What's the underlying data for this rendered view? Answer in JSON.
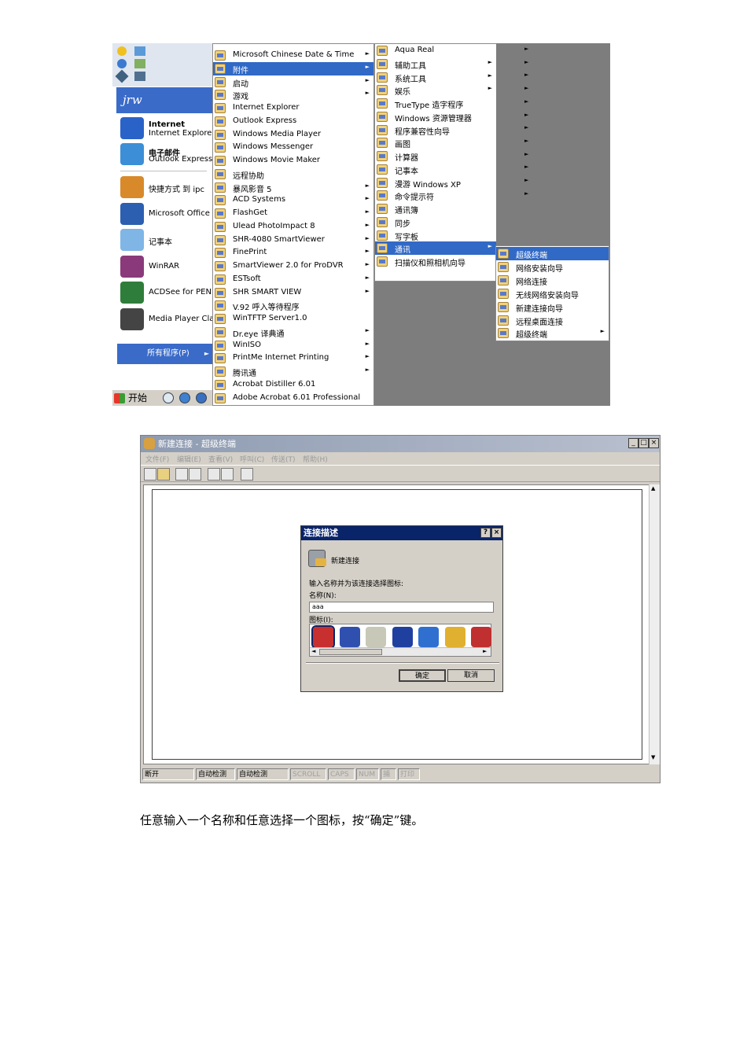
{
  "start_menu": {
    "user_name": "jrw",
    "pinned": [
      {
        "title": "Internet",
        "subtitle": "Internet Explore",
        "icon": "internet-explorer-icon",
        "color": "#2a63c8"
      },
      {
        "title": "电子邮件",
        "subtitle": "Outlook Express",
        "icon": "outlook-express-icon",
        "color": "#3c8fd6"
      }
    ],
    "recent": [
      {
        "label": "快捷方式 到 ipc",
        "icon": "shortcut-icon",
        "color": "#d88a2a"
      },
      {
        "label": "Microsoft Office",
        "icon": "word-icon",
        "color": "#2d5fb0"
      },
      {
        "label": "记事本",
        "icon": "notepad-icon",
        "color": "#7fb6e6"
      },
      {
        "label": "WinRAR",
        "icon": "winrar-icon",
        "color": "#8a3a7a"
      },
      {
        "label": "ACDSee for PEN",
        "icon": "acdsee-icon",
        "color": "#2f7d3a"
      },
      {
        "label": "Media Player Cla",
        "icon": "media-player-icon",
        "color": "#444444"
      }
    ],
    "all_programs": "所有程序(P)",
    "start_button": "开始"
  },
  "programs_menu": [
    {
      "label": "Microsoft Chinese Date & Time",
      "arrow": true
    },
    {
      "label": "附件",
      "arrow": true,
      "selected": true
    },
    {
      "label": "启动",
      "arrow": true
    },
    {
      "label": "游戏",
      "arrow": true
    },
    {
      "label": "Internet Explorer",
      "arrow": false
    },
    {
      "label": "Outlook Express",
      "arrow": false
    },
    {
      "label": "Windows Media Player",
      "arrow": false
    },
    {
      "label": "Windows Messenger",
      "arrow": false
    },
    {
      "label": "Windows Movie Maker",
      "arrow": false
    },
    {
      "label": "远程协助",
      "arrow": false
    },
    {
      "label": "暴风影音 5",
      "arrow": true
    },
    {
      "label": "ACD Systems",
      "arrow": true
    },
    {
      "label": "FlashGet",
      "arrow": true
    },
    {
      "label": "Ulead PhotoImpact 8",
      "arrow": true
    },
    {
      "label": "SHR-4080 SmartViewer",
      "arrow": true
    },
    {
      "label": "FinePrint",
      "arrow": true
    },
    {
      "label": "SmartViewer 2.0 for ProDVR",
      "arrow": true
    },
    {
      "label": "ESTsoft",
      "arrow": true
    },
    {
      "label": "SHR SMART VIEW",
      "arrow": true
    },
    {
      "label": "V.92 呼入等待程序",
      "arrow": false
    },
    {
      "label": "WinTFTP Server1.0",
      "arrow": false
    },
    {
      "label": "Dr.eye 译典通",
      "arrow": true
    },
    {
      "label": "WinISO",
      "arrow": true
    },
    {
      "label": "PrintMe Internet Printing",
      "arrow": true
    },
    {
      "label": "腾讯通",
      "arrow": true
    },
    {
      "label": "Acrobat Distiller 6.01",
      "arrow": false
    },
    {
      "label": "Adobe Acrobat 6.01 Professional",
      "arrow": false
    }
  ],
  "accessories_menu": [
    {
      "label": "Aqua Real",
      "arrow": false
    },
    {
      "label": "辅助工具",
      "arrow": true
    },
    {
      "label": "系统工具",
      "arrow": true
    },
    {
      "label": "娱乐",
      "arrow": true
    },
    {
      "label": "TrueType 造字程序",
      "arrow": false
    },
    {
      "label": "Windows 资源管理器",
      "arrow": false
    },
    {
      "label": "程序兼容性向导",
      "arrow": false
    },
    {
      "label": "画图",
      "arrow": false
    },
    {
      "label": "计算器",
      "arrow": false
    },
    {
      "label": "记事本",
      "arrow": false
    },
    {
      "label": "漫游 Windows XP",
      "arrow": false
    },
    {
      "label": "命令提示符",
      "arrow": false
    },
    {
      "label": "通讯簿",
      "arrow": false
    },
    {
      "label": "同步",
      "arrow": false
    },
    {
      "label": "写字板",
      "arrow": false
    },
    {
      "label": "通讯",
      "arrow": true,
      "selected": true
    },
    {
      "label": "扫描仪和照相机向导",
      "arrow": false
    }
  ],
  "communications_menu": [
    {
      "label": "超级终端",
      "arrow": false,
      "selected": true
    },
    {
      "label": "网络安装向导",
      "arrow": false
    },
    {
      "label": "网络连接",
      "arrow": false
    },
    {
      "label": "无线网络安装向导",
      "arrow": false
    },
    {
      "label": "新建连接向导",
      "arrow": false
    },
    {
      "label": "远程桌面连接",
      "arrow": false
    },
    {
      "label": "超级终端",
      "arrow": true
    }
  ],
  "hyperterminal": {
    "title": "新建连接 - 超级终端",
    "menu": [
      "文件(F)",
      "编辑(E)",
      "查看(V)",
      "呼叫(C)",
      "传送(T)",
      "帮助(H)"
    ],
    "status": [
      "断开",
      "自动检测",
      "自动检测",
      "SCROLL",
      "CAPS",
      "NUM",
      "捕",
      "打印"
    ]
  },
  "dialog": {
    "title": "连接描述",
    "heading": "新建连接",
    "prompt": "输入名称并为该连接选择图标:",
    "name_label": "名称(N):",
    "name_value": "aaa",
    "icon_label": "图标(I):",
    "ok": "确定",
    "cancel": "取消",
    "icons": [
      {
        "name": "red-phone-icon",
        "color": "#c83030"
      },
      {
        "name": "globe-phone-icon",
        "color": "#3050b0"
      },
      {
        "name": "fax-phone-icon",
        "color": "#c8c8b8"
      },
      {
        "name": "mci-phone-icon",
        "color": "#2040a0"
      },
      {
        "name": "globe-icon",
        "color": "#2f6fd0"
      },
      {
        "name": "printer-phone-icon",
        "color": "#e0b030"
      },
      {
        "name": "satellite-icon",
        "color": "#c03030"
      }
    ]
  },
  "caption": "任意输入一个名称和任意选择一个图标，按“确定”键。"
}
